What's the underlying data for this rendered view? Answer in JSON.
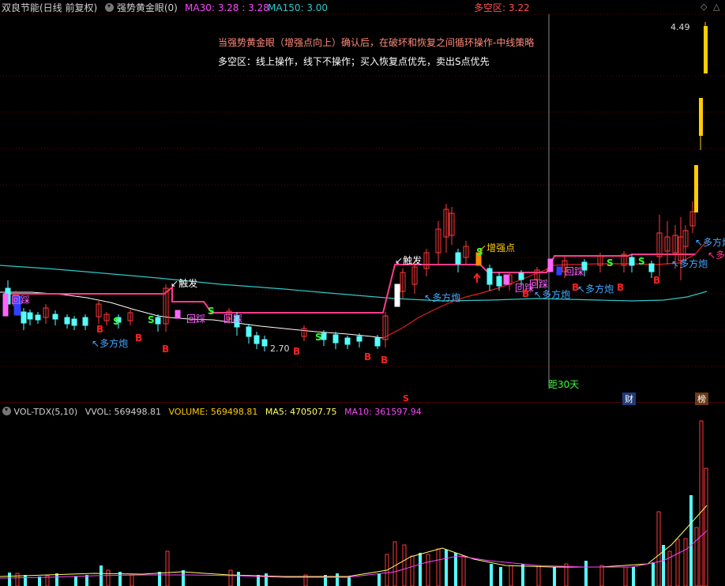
{
  "header": {
    "stock_title": "双良节能(日线 前复权)",
    "indicator_name": "强势黄金眼(0)",
    "ma30_label": "MA30:",
    "ma30_value": "3.28",
    "ma30_value2": "3.28",
    "ma150_label": "MA150:",
    "ma150_value": "3.00",
    "zone_label": "多空区:",
    "zone_value": "3.22"
  },
  "notes": {
    "line1": "当强势黄金眼（增强点向上）确认后，在破坏和恢复之间循环操作-中线策略",
    "line2": "多空区：线上操作，线下不操作；买入恢复点优先，卖出S点优先"
  },
  "annotations": {
    "high_price": "4.49",
    "low_price": "2.70",
    "trigger": "触发",
    "strength_point": "增强点",
    "multi_cannon": "多方炮",
    "pullback": "回踩",
    "buy": "B",
    "sell": "S",
    "distance": "距30天",
    "finance": "财",
    "news": "榜",
    "multi_partial": "多空"
  },
  "volume_header": {
    "indicator": "VOL-TDX(5,10)",
    "vvol_label": "VVOL:",
    "vvol_value": "569498.81",
    "volume_label": "VOLUME:",
    "volume_value": "569498.81",
    "ma5_label": "MA5:",
    "ma5_value": "470507.75",
    "ma10_label": "MA10:",
    "ma10_value": "361597.94"
  },
  "colors": {
    "up": "#ff3a3a",
    "down": "#54ffff",
    "ma30": "#ff3a8c",
    "ma150": "#2ec8c8",
    "zone": "#e02020",
    "white_line": "#ffffff",
    "yellow": "#ffcc00",
    "magenta": "#ff44ff",
    "buy_marker": "#ff2020",
    "sell_marker": "#33ff33"
  }
}
